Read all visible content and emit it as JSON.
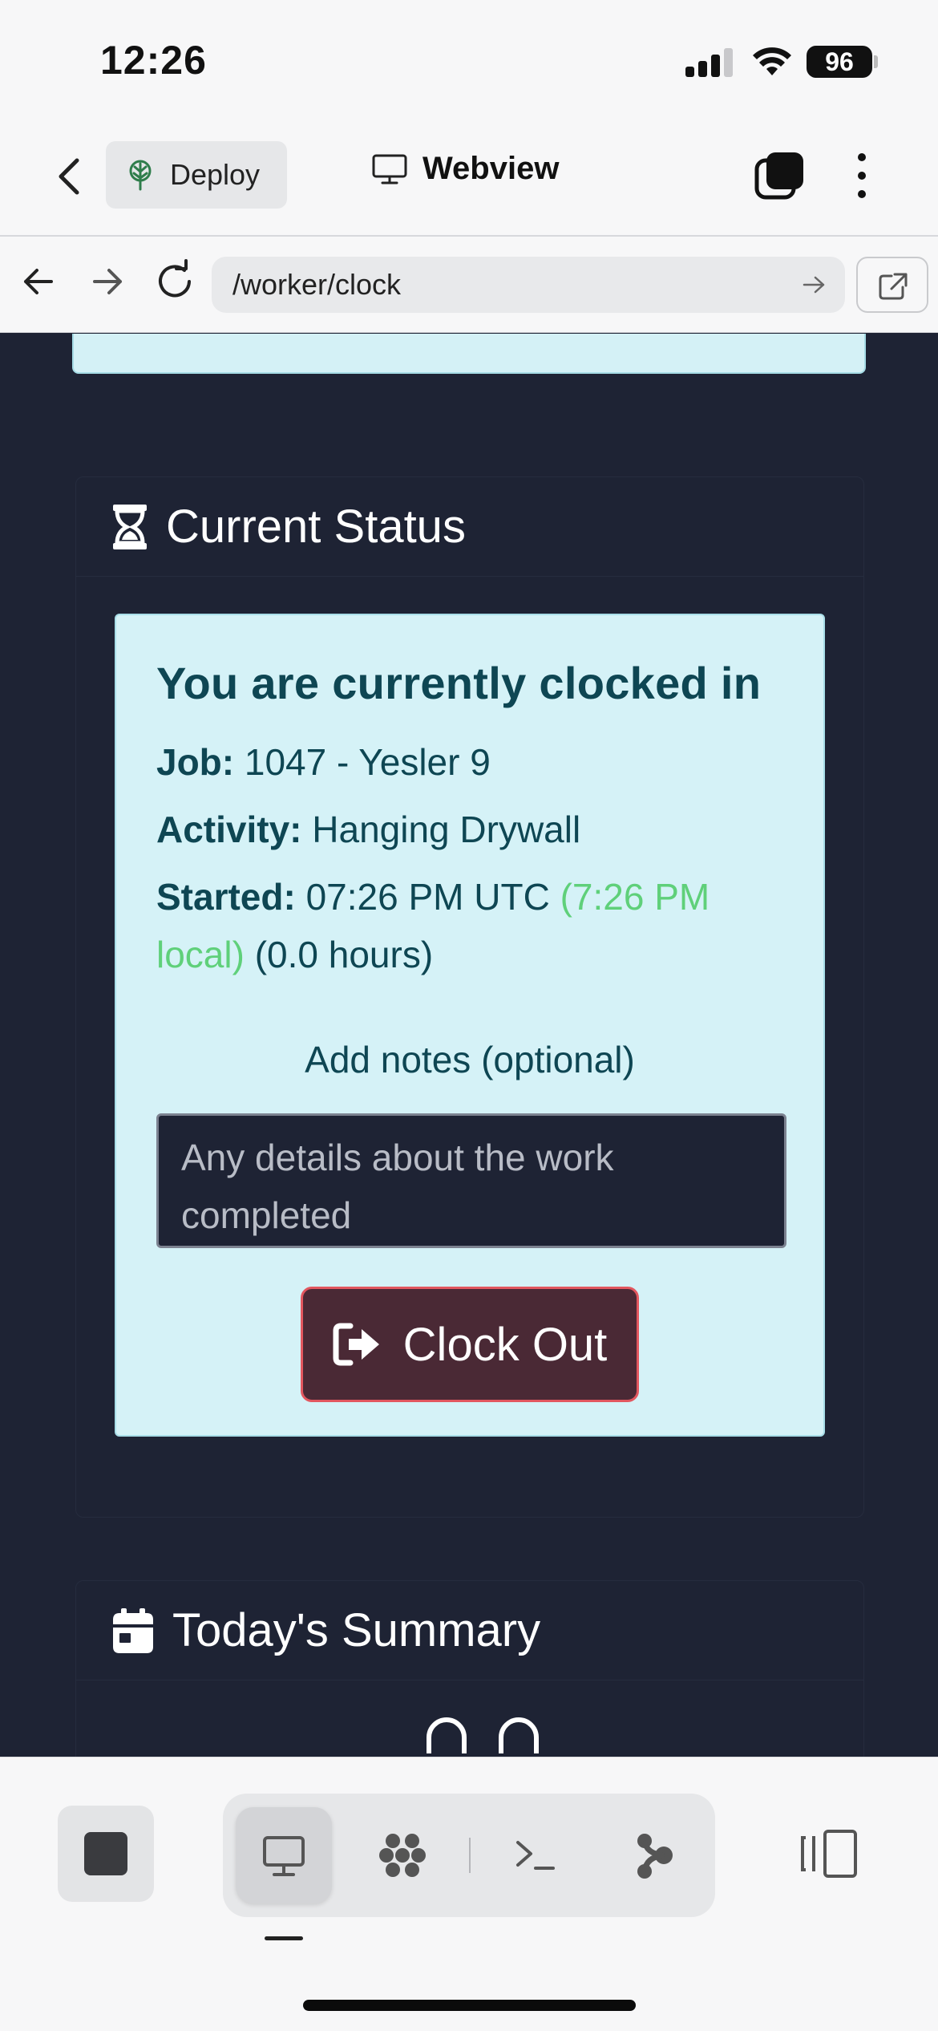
{
  "status_bar": {
    "time": "12:26",
    "battery": "96",
    "icons": [
      "signal-icon",
      "wifi-icon",
      "battery-icon"
    ]
  },
  "app_header": {
    "deploy_label": "Deploy",
    "title": "Webview",
    "icons": [
      "back-chevron-icon",
      "tree-icon",
      "monitor-icon",
      "tabs-icon",
      "more-vertical-icon"
    ]
  },
  "browser": {
    "url": "/worker/clock",
    "icons": [
      "arrow-left-icon",
      "arrow-right-icon",
      "reload-icon",
      "arrow-right-icon",
      "open-external-icon"
    ]
  },
  "current_status": {
    "title": "Current Status",
    "icon": "hourglass-icon",
    "alert_heading": "You are currently clocked in",
    "job_label": "Job:",
    "job_value": "1047 - Yesler 9",
    "activity_label": "Activity:",
    "activity_value": "Hanging Drywall",
    "started_label": "Started:",
    "started_value": "07:26 PM UTC",
    "started_local": "(7:26 PM local)",
    "started_hours": "(0.0 hours)",
    "notes_label": "Add notes (optional)",
    "notes_placeholder": "Any details about the work completed",
    "notes_value": "",
    "clock_out_label": "Clock Out",
    "clock_out_icon": "sign-out-icon"
  },
  "todays_summary": {
    "title": "Today's Summary",
    "icon": "calendar-icon"
  },
  "bottom_toolbar": {
    "icons": [
      "stop-icon",
      "monitor-icon",
      "grid-icon",
      "terminal-icon",
      "branch-icon",
      "side-panel-icon"
    ],
    "active_tab": "monitor"
  },
  "colors": {
    "page_bg": "#1e2334",
    "alert_bg": "#d5f2f7",
    "alert_text": "#0e4653",
    "local_time": "#5fd07a",
    "danger_border": "#e2575f"
  }
}
